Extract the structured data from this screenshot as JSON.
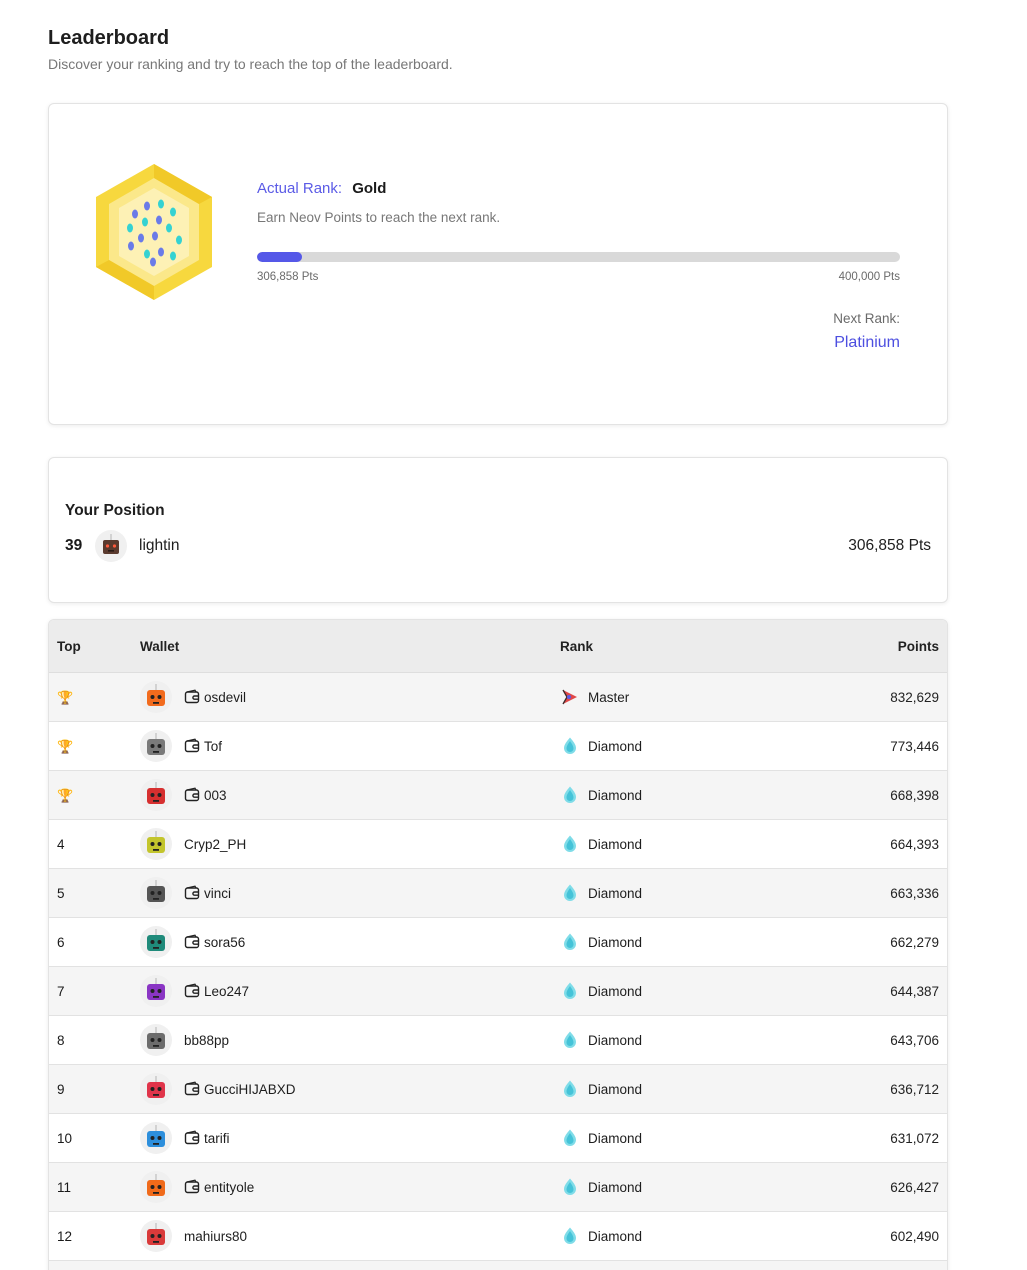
{
  "header": {
    "title": "Leaderboard",
    "subtitle": "Discover your ranking and try to reach the top of the leaderboard."
  },
  "rank_card": {
    "actual_rank_label": "Actual Rank:",
    "actual_rank_value": "Gold",
    "hint": "Earn Neov Points to reach the next rank.",
    "progress_fraction": 0.07,
    "current_points_label": "306,858 Pts",
    "target_points_label": "400,000 Pts",
    "next_rank_label": "Next Rank:",
    "next_rank_value": "Platinium",
    "badge_color": "#f7d94c"
  },
  "position": {
    "title": "Your Position",
    "number": "39",
    "name": "lightin",
    "points": "306,858 Pts"
  },
  "table": {
    "headers": {
      "top": "Top",
      "wallet": "Wallet",
      "rank": "Rank",
      "points": "Points"
    },
    "rows": [
      {
        "top": "",
        "trophy": true,
        "name": "osdevil",
        "wallet": true,
        "rank": "Master",
        "points": "832,629",
        "avatar_color": "#f26b1d"
      },
      {
        "top": "",
        "trophy": true,
        "name": "Tof",
        "wallet": true,
        "rank": "Diamond",
        "points": "773,446",
        "avatar_color": "#7a7a7a"
      },
      {
        "top": "",
        "trophy": true,
        "name": "003",
        "wallet": true,
        "rank": "Diamond",
        "points": "668,398",
        "avatar_color": "#d62f2f"
      },
      {
        "top": "4",
        "trophy": false,
        "name": "Cryp2_PH",
        "wallet": false,
        "rank": "Diamond",
        "points": "664,393",
        "avatar_color": "#c3c52d"
      },
      {
        "top": "5",
        "trophy": false,
        "name": "vinci",
        "wallet": true,
        "rank": "Diamond",
        "points": "663,336",
        "avatar_color": "#555555"
      },
      {
        "top": "6",
        "trophy": false,
        "name": "sora56",
        "wallet": true,
        "rank": "Diamond",
        "points": "662,279",
        "avatar_color": "#1f8a7a"
      },
      {
        "top": "7",
        "trophy": false,
        "name": "Leo247",
        "wallet": true,
        "rank": "Diamond",
        "points": "644,387",
        "avatar_color": "#8a35c4"
      },
      {
        "top": "8",
        "trophy": false,
        "name": "bb88pp",
        "wallet": false,
        "rank": "Diamond",
        "points": "643,706",
        "avatar_color": "#6c6c6c"
      },
      {
        "top": "9",
        "trophy": false,
        "name": "GucciHIJABXD",
        "wallet": true,
        "rank": "Diamond",
        "points": "636,712",
        "avatar_color": "#e0344a"
      },
      {
        "top": "10",
        "trophy": false,
        "name": "tarifi",
        "wallet": true,
        "rank": "Diamond",
        "points": "631,072",
        "avatar_color": "#2d8fdc"
      },
      {
        "top": "11",
        "trophy": false,
        "name": "entityole",
        "wallet": true,
        "rank": "Diamond",
        "points": "626,427",
        "avatar_color": "#f06a1a"
      },
      {
        "top": "12",
        "trophy": false,
        "name": "mahiurs80",
        "wallet": false,
        "rank": "Diamond",
        "points": "602,490",
        "avatar_color": "#d93a3a"
      }
    ]
  },
  "icons": {
    "trophy": "trophy-icon",
    "wallet": "wallet-icon",
    "master": "master-rank-icon",
    "diamond": "diamond-rank-icon"
  }
}
